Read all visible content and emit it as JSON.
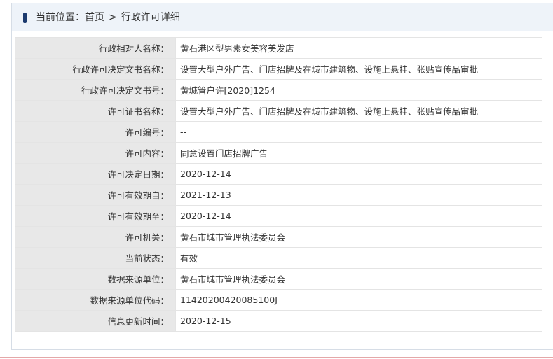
{
  "breadcrumb": {
    "prefix": "当前位置：",
    "home": "首页",
    "separator": ">",
    "current": "行政许可详细"
  },
  "rows": [
    {
      "label": "行政相对人名称：",
      "value": "黄石港区型男素女美容美发店"
    },
    {
      "label": "行政许可决定文书名称：",
      "value": "设置大型户外广告、门店招牌及在城市建筑物、设施上悬挂、张贴宣传品审批"
    },
    {
      "label": "行政许可决定文书号：",
      "value": "黄城管户许[2020]1254"
    },
    {
      "label": "许可证书名称：",
      "value": "设置大型户外广告、门店招牌及在城市建筑物、设施上悬挂、张贴宣传品审批"
    },
    {
      "label": "许可编号：",
      "value": "--"
    },
    {
      "label": "许可内容：",
      "value": "同意设置门店招牌广告"
    },
    {
      "label": "许可决定日期：",
      "value": "2020-12-14"
    },
    {
      "label": "许可有效期自：",
      "value": "2021-12-13"
    },
    {
      "label": "许可有效期至：",
      "value": "2020-12-14"
    },
    {
      "label": "许可机关：",
      "value": "黄石市城市管理执法委员会"
    },
    {
      "label": "当前状态：",
      "value": "有效"
    },
    {
      "label": "数据来源单位：",
      "value": "黄石市城市管理执法委员会"
    },
    {
      "label": "数据来源单位代码：",
      "value": "11420200420085100J"
    },
    {
      "label": "信息更新时间：",
      "value": "2020-12-15"
    }
  ],
  "colors": {
    "marker": "#1c3a6e",
    "crumb_bg": "#eef3f9",
    "label_bg": "#e8e8e8"
  }
}
